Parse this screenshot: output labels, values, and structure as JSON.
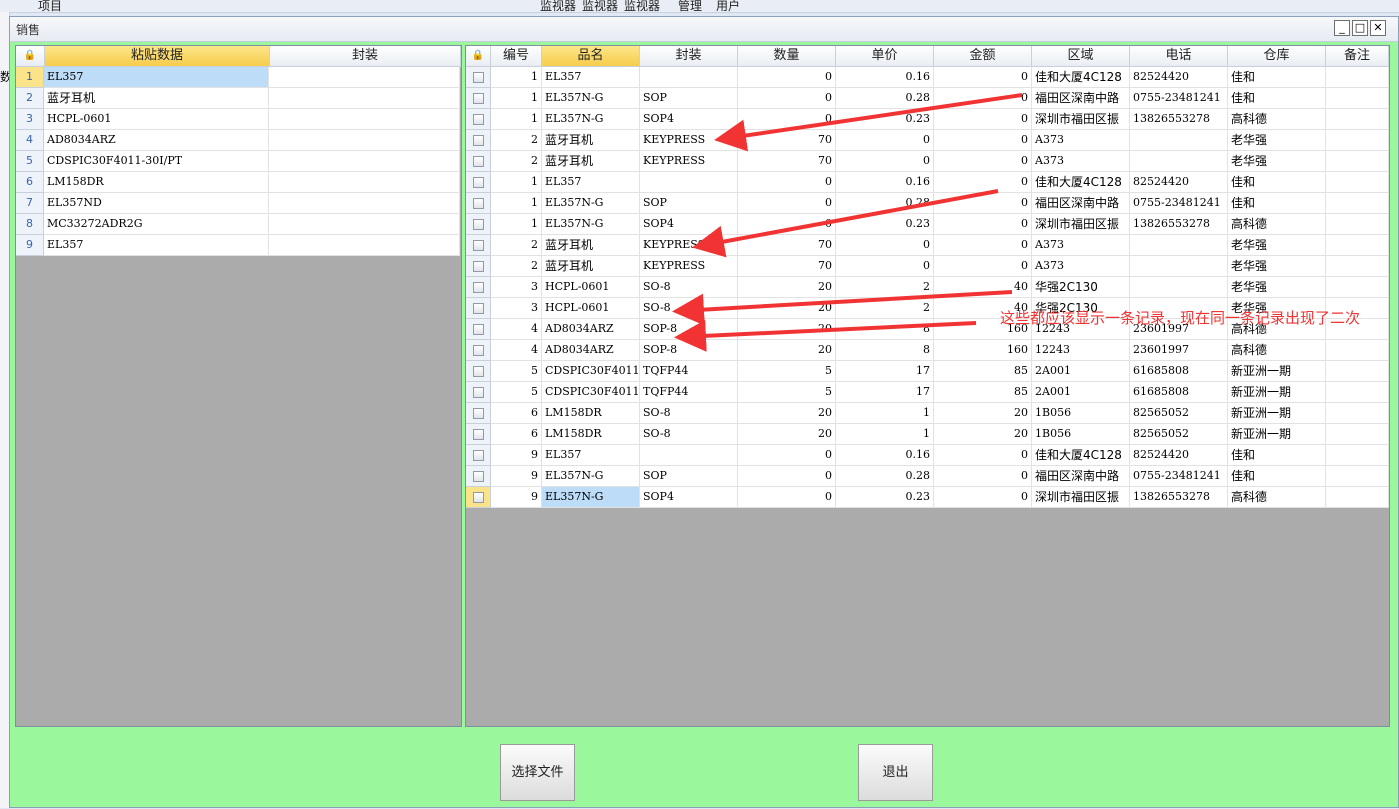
{
  "background": {
    "labels": [
      "项目",
      "监视器",
      "监视器",
      "监视器",
      "管理",
      "用户"
    ],
    "side_label": "数"
  },
  "window": {
    "title": "销售",
    "controls": [
      "minimize",
      "maximize",
      "close"
    ]
  },
  "left_grid": {
    "columns": [
      "粘贴数据",
      "封装"
    ],
    "rows": [
      {
        "no": "1",
        "data": "EL357",
        "pkg": ""
      },
      {
        "no": "2",
        "data": "蓝牙耳机",
        "pkg": ""
      },
      {
        "no": "3",
        "data": "HCPL-0601",
        "pkg": ""
      },
      {
        "no": "4",
        "data": "AD8034ARZ",
        "pkg": ""
      },
      {
        "no": "5",
        "data": "CDSPIC30F4011-30I/PT",
        "pkg": ""
      },
      {
        "no": "6",
        "data": "LM158DR",
        "pkg": ""
      },
      {
        "no": "7",
        "data": "EL357ND",
        "pkg": ""
      },
      {
        "no": "8",
        "data": "MC33272ADR2G",
        "pkg": ""
      },
      {
        "no": "9",
        "data": "EL357",
        "pkg": ""
      }
    ]
  },
  "right_grid": {
    "columns": [
      "编号",
      "品名",
      "封装",
      "数量",
      "单价",
      "金额",
      "区域",
      "电话",
      "仓库",
      "备注"
    ],
    "rows": [
      {
        "no": "1",
        "name": "EL357",
        "pkg": "",
        "qty": "0",
        "price": "0.16",
        "amount": "0",
        "area": "佳和大厦4C128",
        "phone": "82524420",
        "warehouse": "佳和",
        "remark": ""
      },
      {
        "no": "1",
        "name": "EL357N-G",
        "pkg": "SOP",
        "qty": "0",
        "price": "0.28",
        "amount": "0",
        "area": "福田区深南中路",
        "phone": "0755-23481241",
        "warehouse": "佳和",
        "remark": ""
      },
      {
        "no": "1",
        "name": "EL357N-G",
        "pkg": "SOP4",
        "qty": "0",
        "price": "0.23",
        "amount": "0",
        "area": "深圳市福田区振",
        "phone": "13826553278",
        "warehouse": "高科德",
        "remark": ""
      },
      {
        "no": "2",
        "name": "蓝牙耳机",
        "pkg": "KEYPRESS",
        "qty": "70",
        "price": "0",
        "amount": "0",
        "area": "A373",
        "phone": "",
        "warehouse": "老华强",
        "remark": ""
      },
      {
        "no": "2",
        "name": "蓝牙耳机",
        "pkg": "KEYPRESS",
        "qty": "70",
        "price": "0",
        "amount": "0",
        "area": "A373",
        "phone": "",
        "warehouse": "老华强",
        "remark": ""
      },
      {
        "no": "1",
        "name": "EL357",
        "pkg": "",
        "qty": "0",
        "price": "0.16",
        "amount": "0",
        "area": "佳和大厦4C128",
        "phone": "82524420",
        "warehouse": "佳和",
        "remark": ""
      },
      {
        "no": "1",
        "name": "EL357N-G",
        "pkg": "SOP",
        "qty": "0",
        "price": "0.28",
        "amount": "0",
        "area": "福田区深南中路",
        "phone": "0755-23481241",
        "warehouse": "佳和",
        "remark": ""
      },
      {
        "no": "1",
        "name": "EL357N-G",
        "pkg": "SOP4",
        "qty": "0",
        "price": "0.23",
        "amount": "0",
        "area": "深圳市福田区振",
        "phone": "13826553278",
        "warehouse": "高科德",
        "remark": ""
      },
      {
        "no": "2",
        "name": "蓝牙耳机",
        "pkg": "KEYPRESS",
        "qty": "70",
        "price": "0",
        "amount": "0",
        "area": "A373",
        "phone": "",
        "warehouse": "老华强",
        "remark": ""
      },
      {
        "no": "2",
        "name": "蓝牙耳机",
        "pkg": "KEYPRESS",
        "qty": "70",
        "price": "0",
        "amount": "0",
        "area": "A373",
        "phone": "",
        "warehouse": "老华强",
        "remark": ""
      },
      {
        "no": "3",
        "name": "HCPL-0601",
        "pkg": "SO-8",
        "qty": "20",
        "price": "2",
        "amount": "40",
        "area": "华强2C130",
        "phone": "",
        "warehouse": "老华强",
        "remark": ""
      },
      {
        "no": "3",
        "name": "HCPL-0601",
        "pkg": "SO-8",
        "qty": "20",
        "price": "2",
        "amount": "40",
        "area": "华强2C130",
        "phone": "",
        "warehouse": "老华强",
        "remark": ""
      },
      {
        "no": "4",
        "name": "AD8034ARZ",
        "pkg": "SOP-8",
        "qty": "20",
        "price": "8",
        "amount": "160",
        "area": "12243",
        "phone": "23601997",
        "warehouse": "高科德",
        "remark": ""
      },
      {
        "no": "4",
        "name": "AD8034ARZ",
        "pkg": "SOP-8",
        "qty": "20",
        "price": "8",
        "amount": "160",
        "area": "12243",
        "phone": "23601997",
        "warehouse": "高科德",
        "remark": ""
      },
      {
        "no": "5",
        "name": "CDSPIC30F4011-",
        "pkg": "TQFP44",
        "qty": "5",
        "price": "17",
        "amount": "85",
        "area": "2A001",
        "phone": "61685808",
        "warehouse": "新亚洲一期",
        "remark": ""
      },
      {
        "no": "5",
        "name": "CDSPIC30F4011-",
        "pkg": "TQFP44",
        "qty": "5",
        "price": "17",
        "amount": "85",
        "area": "2A001",
        "phone": "61685808",
        "warehouse": "新亚洲一期",
        "remark": ""
      },
      {
        "no": "6",
        "name": "LM158DR",
        "pkg": "SO-8",
        "qty": "20",
        "price": "1",
        "amount": "20",
        "area": "1B056",
        "phone": "82565052",
        "warehouse": "新亚洲一期",
        "remark": ""
      },
      {
        "no": "6",
        "name": "LM158DR",
        "pkg": "SO-8",
        "qty": "20",
        "price": "1",
        "amount": "20",
        "area": "1B056",
        "phone": "82565052",
        "warehouse": "新亚洲一期",
        "remark": ""
      },
      {
        "no": "9",
        "name": "EL357",
        "pkg": "",
        "qty": "0",
        "price": "0.16",
        "amount": "0",
        "area": "佳和大厦4C128",
        "phone": "82524420",
        "warehouse": "佳和",
        "remark": ""
      },
      {
        "no": "9",
        "name": "EL357N-G",
        "pkg": "SOP",
        "qty": "0",
        "price": "0.28",
        "amount": "0",
        "area": "福田区深南中路",
        "phone": "0755-23481241",
        "warehouse": "佳和",
        "remark": ""
      },
      {
        "no": "9",
        "name": "EL357N-G",
        "pkg": "SOP4",
        "qty": "0",
        "price": "0.23",
        "amount": "0",
        "area": "深圳市福田区振",
        "phone": "13826553278",
        "warehouse": "高科德",
        "remark": ""
      }
    ]
  },
  "buttons": {
    "select_file": "选择文件",
    "exit": "退出"
  },
  "annotation": {
    "text": "这些都应该显示一条记录，现在同一条记录出现了二次",
    "color": "#f23333"
  },
  "colors": {
    "window_bg": "#9bf79b",
    "header_active": "#f6cc4b",
    "selection": "#bcdcf8",
    "arrow": "#f23333"
  }
}
